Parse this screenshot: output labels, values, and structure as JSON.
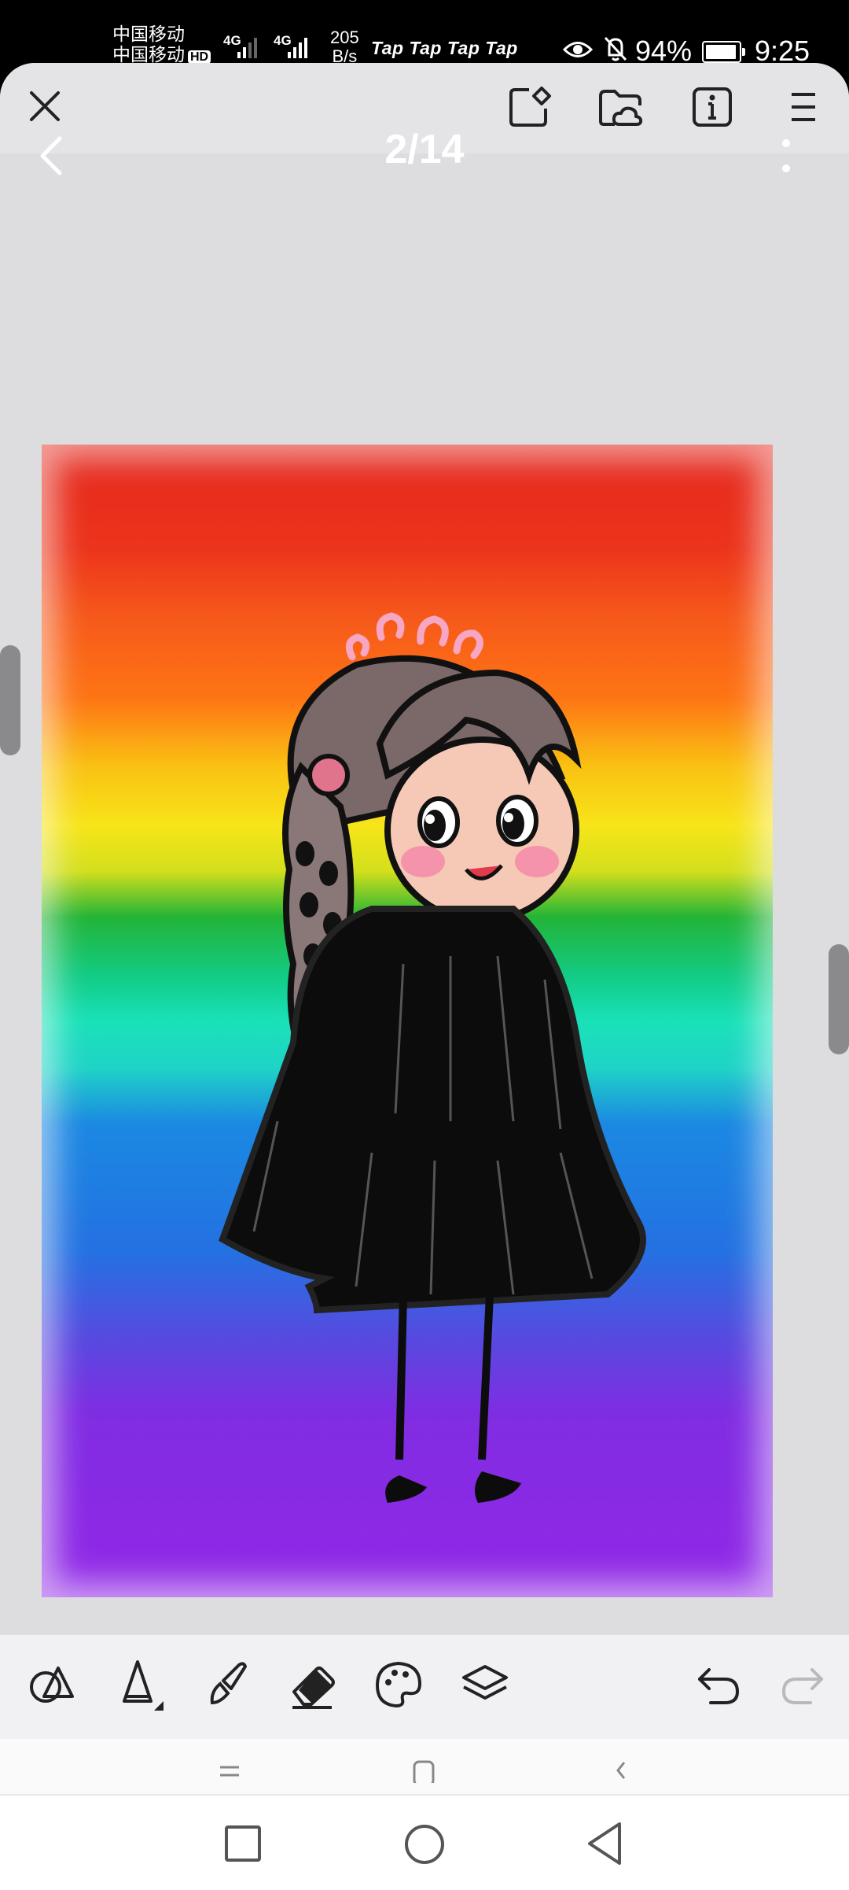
{
  "status_bar": {
    "carrier_1": "中国移动",
    "carrier_2": "中国移动",
    "hd_badge": "HD",
    "network_1": "4G",
    "network_2": "4G",
    "speed_value": "205",
    "speed_unit": "B/s",
    "notifications": "Tap Tap Tap Tap",
    "battery_percent": "94%",
    "battery_level": 0.94,
    "time": "9:25"
  },
  "viewer": {
    "page_counter": "2/14"
  },
  "icons": {
    "close": "close-icon",
    "share": "share-icon",
    "cloud_folder": "cloud-folder-icon",
    "info": "info-icon",
    "menu": "menu-icon",
    "back": "back-arrow-icon",
    "more": "more-vertical-icon",
    "shapes": "shapes-icon",
    "pencil": "pencil-icon",
    "brush": "brush-icon",
    "eraser": "eraser-icon",
    "palette": "palette-icon",
    "layers": "layers-icon",
    "undo": "undo-icon",
    "redo": "redo-icon"
  },
  "colors": {
    "app_background": "#dddcdf",
    "toolbar_background": "#f1f0f3",
    "redo_disabled": "#b9b9bd"
  }
}
